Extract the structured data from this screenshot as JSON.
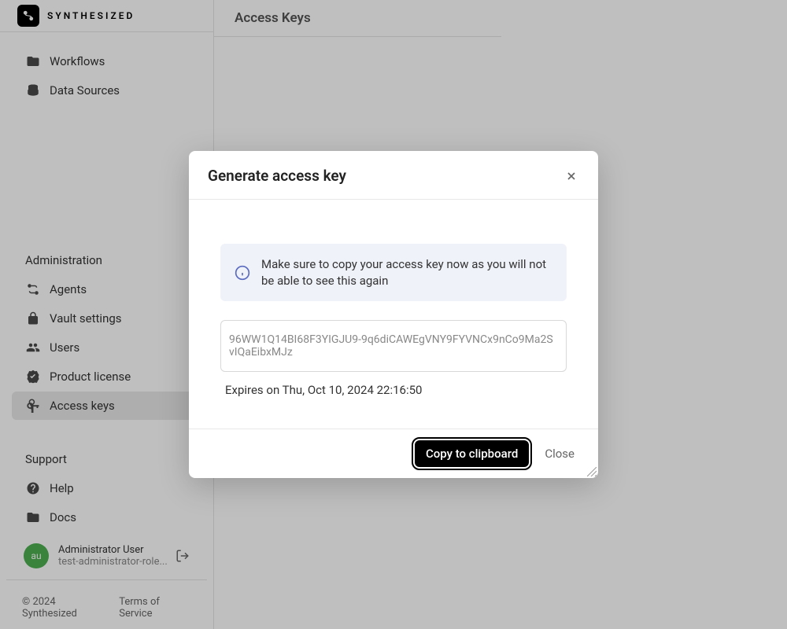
{
  "brand": {
    "name": "SYNTHESIZED"
  },
  "nav_top": {
    "items": [
      {
        "label": "Workflows"
      },
      {
        "label": "Data Sources"
      }
    ]
  },
  "sections": {
    "administration": {
      "title": "Administration",
      "items": [
        {
          "label": "Agents"
        },
        {
          "label": "Vault settings"
        },
        {
          "label": "Users"
        },
        {
          "label": "Product license"
        },
        {
          "label": "Access keys"
        }
      ]
    },
    "support": {
      "title": "Support",
      "items": [
        {
          "label": "Help"
        },
        {
          "label": "Docs"
        }
      ]
    }
  },
  "user": {
    "avatar_initials": "au",
    "name": "Administrator User",
    "role": "test-administrator-role..."
  },
  "footer": {
    "copyright": "© 2024 Synthesized",
    "tos": "Terms of Service"
  },
  "page": {
    "title": "Access Keys"
  },
  "modal": {
    "title": "Generate access key",
    "info_text": "Make sure to copy your access key now as you will not be able to see this again",
    "key_value": "96WW1Q14BI68F3YIGJU9-9q6diCAWEgVNY9FYVNCx9nCo9Ma2SvIQaEibxMJz",
    "expires_text": "Expires on Thu, Oct 10, 2024 22:16:50",
    "copy_button": "Copy to clipboard",
    "close_button": "Close"
  }
}
